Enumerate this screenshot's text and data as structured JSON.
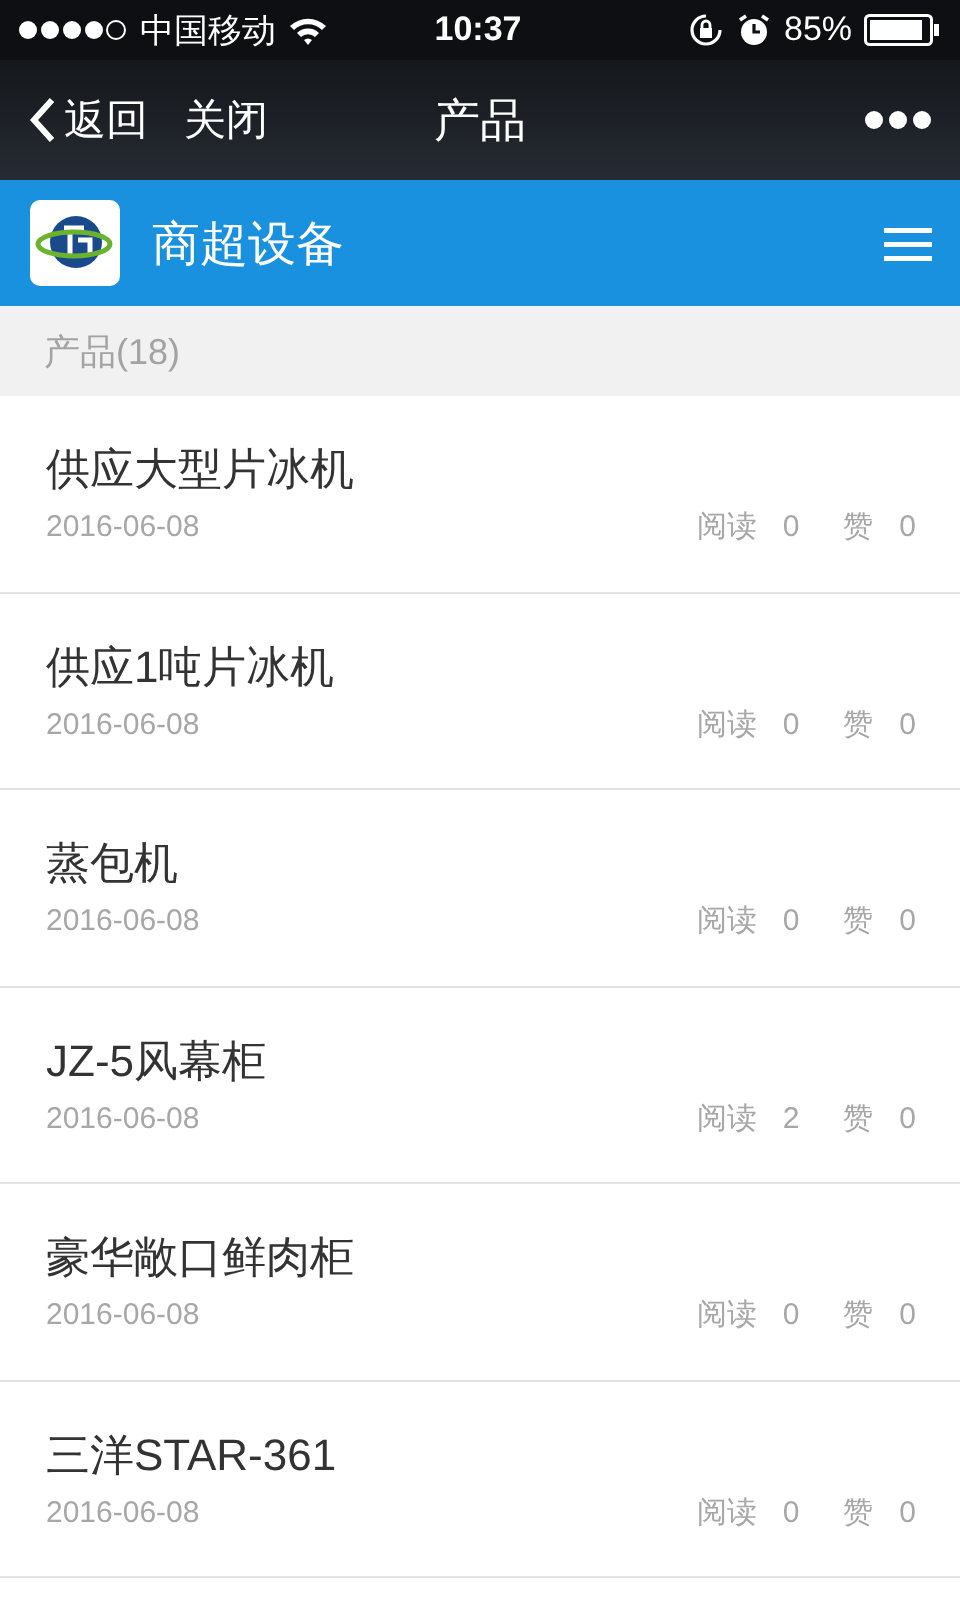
{
  "status_bar": {
    "carrier": "中国移动",
    "time": "10:37",
    "battery": "85%"
  },
  "nav_bar": {
    "back": "返回",
    "close": "关闭",
    "title": "产品"
  },
  "site_header": {
    "title": "商超设备"
  },
  "section": {
    "title": "产品(18)"
  },
  "items": [
    {
      "title": "供应大型片冰机",
      "date": "2016-06-08",
      "reads_label": "阅读",
      "reads": "0",
      "likes_label": "赞",
      "likes": "0"
    },
    {
      "title": "供应1吨片冰机",
      "date": "2016-06-08",
      "reads_label": "阅读",
      "reads": "0",
      "likes_label": "赞",
      "likes": "0"
    },
    {
      "title": "蒸包机",
      "date": "2016-06-08",
      "reads_label": "阅读",
      "reads": "0",
      "likes_label": "赞",
      "likes": "0"
    },
    {
      "title": "JZ-5风幕柜",
      "date": "2016-06-08",
      "reads_label": "阅读",
      "reads": "2",
      "likes_label": "赞",
      "likes": "0"
    },
    {
      "title": "豪华敞口鲜肉柜",
      "date": "2016-06-08",
      "reads_label": "阅读",
      "reads": "0",
      "likes_label": "赞",
      "likes": "0"
    },
    {
      "title": "三洋STAR-361",
      "date": "2016-06-08",
      "reads_label": "阅读",
      "reads": "0",
      "likes_label": "赞",
      "likes": "0"
    }
  ]
}
